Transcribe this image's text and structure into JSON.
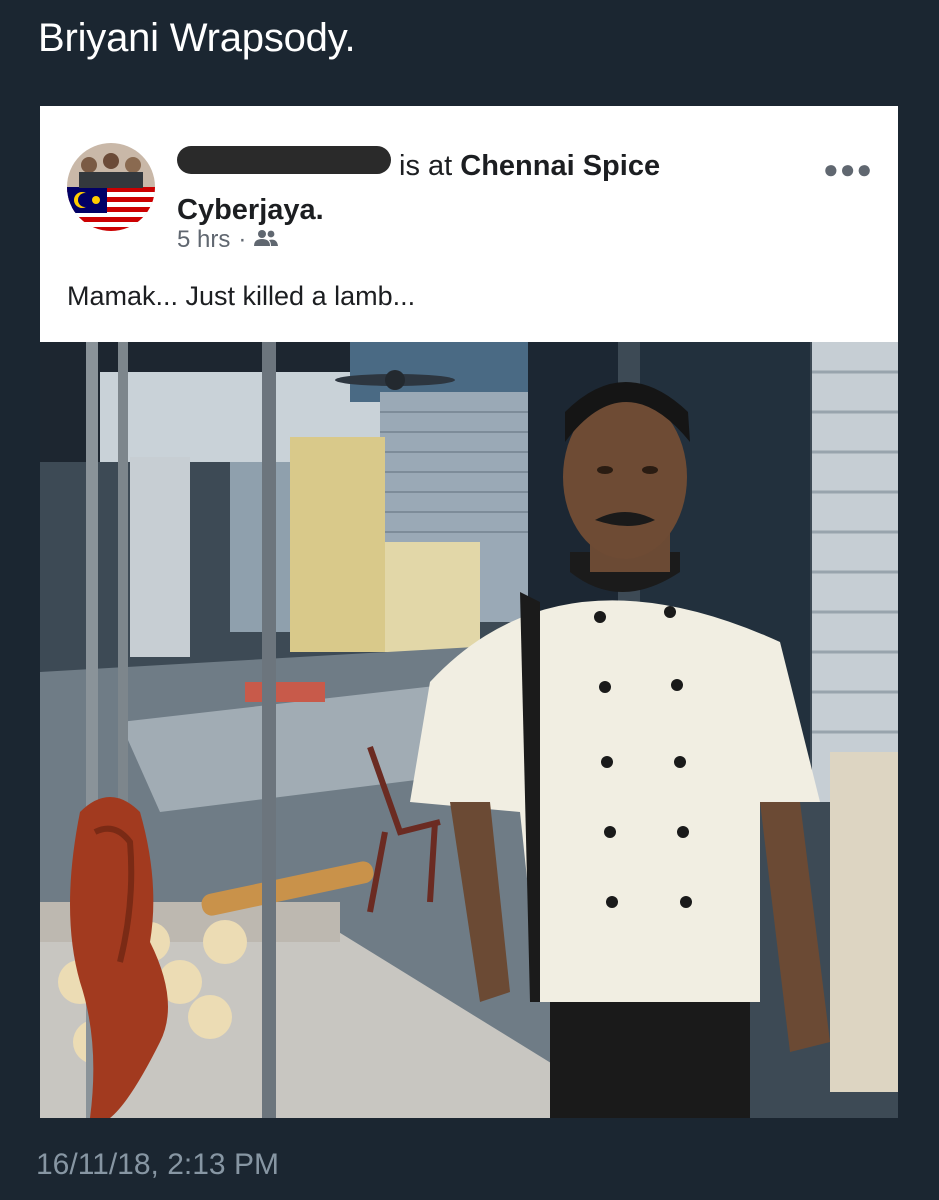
{
  "tweet": {
    "title": "Briyani Wrapsody.",
    "timestamp": "16/11/18, 2:13 PM"
  },
  "post": {
    "checkin_prefix": "is at",
    "place_name_line1": "Chennai Spice",
    "place_name_line2": "Cyberjaya.",
    "time_ago": "5 hrs",
    "separator": "·",
    "audience_icon": "friends-icon",
    "menu_icon": "more-options-icon",
    "text": "Mamak... Just killed a lamb..."
  },
  "colors": {
    "background": "#1b2631",
    "card": "#ffffff",
    "title_text": "#ffffff",
    "timestamp_text": "#8796a3"
  }
}
